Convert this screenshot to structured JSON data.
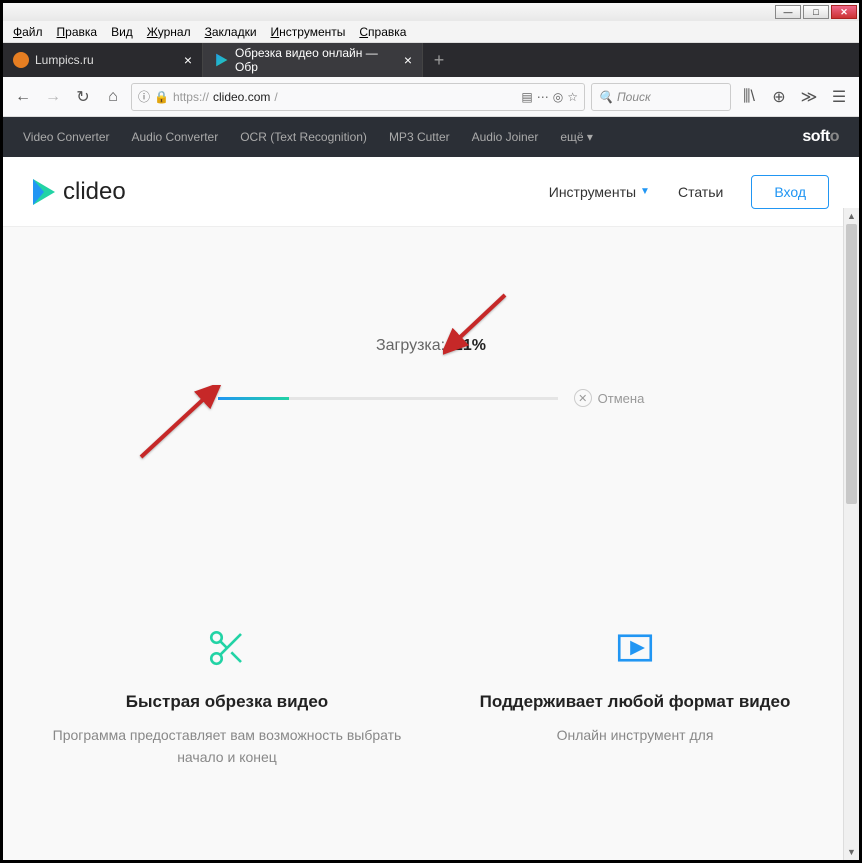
{
  "menubar": [
    "Файл",
    "Правка",
    "Вид",
    "Журнал",
    "Закладки",
    "Инструменты",
    "Справка"
  ],
  "tabs": [
    {
      "title": "Lumpics.ru",
      "icon_color": "#e67e22",
      "active": false
    },
    {
      "title": "Обрезка видео онлайн — Обр",
      "icon_color": "#22d3a5",
      "active": true
    }
  ],
  "url": {
    "proto": "https://",
    "domain": "clideo.com",
    "path": "/"
  },
  "search_placeholder": "Поиск",
  "softo": {
    "links": [
      "Video Converter",
      "Audio Converter",
      "OCR (Text Recognition)",
      "MP3 Cutter",
      "Audio Joiner",
      "ещё"
    ],
    "brand": "softo"
  },
  "header": {
    "logo": "clideo",
    "nav": {
      "tools": "Инструменты",
      "articles": "Статьи",
      "login": "Вход"
    }
  },
  "upload": {
    "label": "Загрузка:",
    "percent_text": "21%",
    "percent": 21,
    "cancel": "Отмена"
  },
  "features": [
    {
      "icon": "scissors",
      "title": "Быстрая обрезка видео",
      "desc": "Программа предоставляет вам возможность выбрать начало и конец"
    },
    {
      "icon": "video",
      "title": "Поддерживает любой формат видео",
      "desc": "Онлайн инструмент для"
    }
  ]
}
